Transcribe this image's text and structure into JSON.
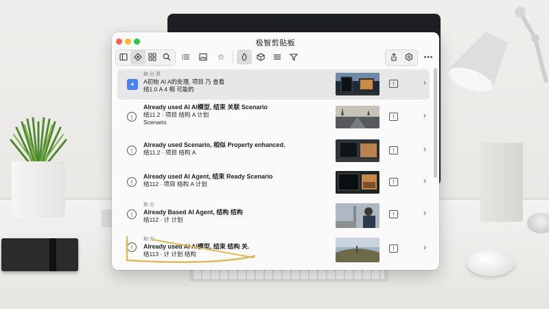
{
  "window": {
    "title": "极智剪贴板"
  },
  "rows": [
    {
      "meta": "和 分 资",
      "title": "A初始 AI A的处理, 项目 乃 查看",
      "sub": "结1.0 A 4 相 可能的",
      "extra": ""
    },
    {
      "meta": "",
      "title": "Already used AI AI模型, 结束 关联 Scenario",
      "sub": "结11.2 · 项目 结构 A 计划",
      "extra": "Scenario"
    },
    {
      "meta": "",
      "title": "Already used Scenario, 相似 Property enhanced.",
      "sub": "结11.2 · 项目 结构 A",
      "extra": ""
    },
    {
      "meta": "",
      "title": "Already used AI Agent, 结束 Ready Scenario",
      "sub": "结112 · 项目 结构 A 计划",
      "extra": ""
    },
    {
      "meta": "和 分",
      "title": "Already Based AI Agent, 结构 结构",
      "sub": "结112 · 计 计划",
      "extra": ""
    },
    {
      "meta": "和 分",
      "title": "Already used AI AI模型, 结束 结构 关.",
      "sub": "结113 · 计 计划 结构",
      "extra": ""
    }
  ],
  "icons": {
    "toolbar": [
      "sidebar-icon",
      "tag-icon",
      "grid-icon",
      "search-icon",
      "list-icon",
      "image-icon",
      "star-icon",
      "flame-icon",
      "box-icon",
      "menu-icon",
      "filter-icon",
      "share-icon",
      "settings-icon",
      "more-icon"
    ],
    "row_badge": "info-icon",
    "row_chevron": "chevron-right-icon"
  },
  "colors": {
    "accent": "#4a80f0",
    "close": "#ff5f57",
    "minimize": "#febc2e",
    "maximize": "#28c840"
  }
}
